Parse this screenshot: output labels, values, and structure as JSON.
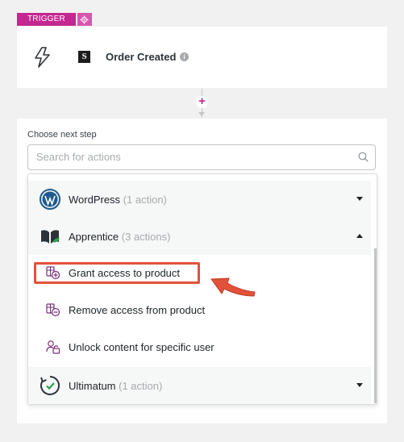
{
  "trigger": {
    "tab_label": "TRIGGER",
    "title": "Order Created",
    "icons": {
      "gear": "gear-icon",
      "bolt": "bolt-icon",
      "logo": "surecart-logo",
      "info": "info-icon"
    }
  },
  "connector": {
    "add_symbol": "+"
  },
  "step": {
    "label": "Choose next step",
    "search_placeholder": "Search for actions",
    "groups": [
      {
        "name": "WordPress",
        "count": "(1 action)",
        "expanded": false,
        "icon": "wordpress-icon"
      },
      {
        "name": "Apprentice",
        "count": "(3 actions)",
        "expanded": true,
        "icon": "apprentice-icon"
      },
      {
        "name": "Ultimatum",
        "count": "(1 action)",
        "expanded": false,
        "icon": "ultimatum-icon"
      }
    ],
    "actions": [
      {
        "label": "Grant access to product",
        "icon": "grant-access-icon",
        "highlighted": true
      },
      {
        "label": "Remove access from product",
        "icon": "remove-access-icon",
        "highlighted": false
      },
      {
        "label": "Unlock content for specific user",
        "icon": "unlock-user-icon",
        "highlighted": false
      }
    ]
  },
  "colors": {
    "accent": "#c2288f",
    "highlight": "#e1523b"
  }
}
